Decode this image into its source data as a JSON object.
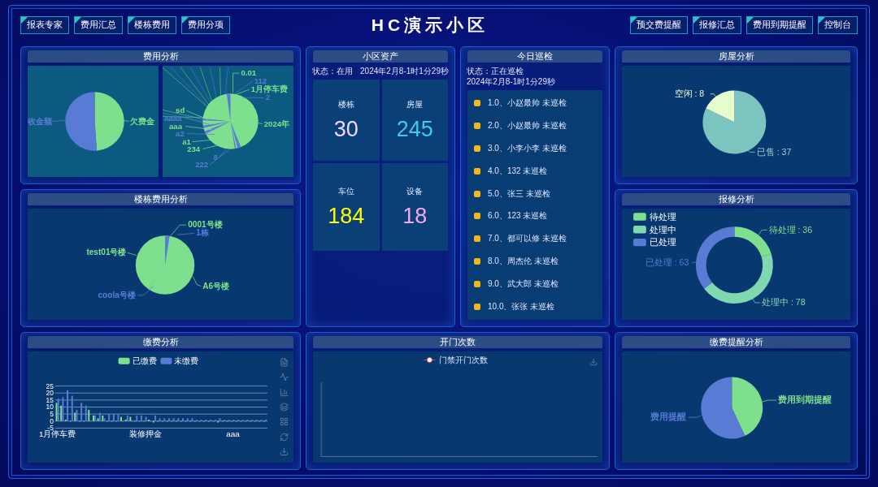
{
  "header": {
    "title": "HC演示小区",
    "left_buttons": [
      "报表专家",
      "费用汇总",
      "楼栋费用",
      "费用分项"
    ],
    "right_buttons": [
      "预交费提醒",
      "报修汇总",
      "费用到期提醒",
      "控制台"
    ]
  },
  "fee_analysis": {
    "title": "费用分析",
    "left_labels": [
      {
        "text": "收金额",
        "color": "#5a7bd5"
      },
      {
        "text": "欠费金",
        "color": "#7ee08e"
      }
    ],
    "right_labels": [
      {
        "text": "0.01",
        "color": "#7ee08e"
      },
      {
        "text": "112",
        "color": "#5a7bd5"
      },
      {
        "text": "1月停车费",
        "color": "#7ee08e"
      },
      {
        "text": "2",
        "color": "#5a7bd5"
      },
      {
        "text": "2024年",
        "color": "#7ee08e"
      },
      {
        "text": "sd",
        "color": "#7ee08e"
      },
      {
        "text": "aaaa",
        "color": "#5a7bd5"
      },
      {
        "text": "aaa",
        "color": "#7ee08e"
      },
      {
        "text": "a2",
        "color": "#5a7bd5"
      },
      {
        "text": "a1",
        "color": "#7ee08e"
      },
      {
        "text": "234",
        "color": "#7ee08e"
      },
      {
        "text": "8",
        "color": "#5a7bd5"
      },
      {
        "text": "222",
        "color": "#5a7bd5"
      }
    ]
  },
  "building_fees": {
    "title": "楼栋费用分析",
    "labels": [
      {
        "text": "0001号楼",
        "color": "#7ee08e"
      },
      {
        "text": "1栋",
        "color": "#5a7bd5"
      },
      {
        "text": "test01号楼",
        "color": "#7ee08e"
      },
      {
        "text": "A6号楼",
        "color": "#7ee08e"
      },
      {
        "text": "coola号楼",
        "color": "#5a7bd5"
      }
    ]
  },
  "payment_analysis": {
    "title": "缴费分析",
    "chart_data": {
      "type": "bar",
      "legend": "top",
      "grid": true,
      "ylim": [
        -5,
        25
      ],
      "yticks": [
        -5,
        0,
        5,
        10,
        15,
        20,
        25
      ],
      "categories": [
        "1月停车费",
        null,
        null,
        null,
        null,
        null,
        null,
        null,
        null,
        null,
        null,
        null,
        null,
        null,
        null,
        null,
        null,
        null,
        null,
        "装修押金",
        null,
        null,
        null,
        null,
        null,
        null,
        null,
        null,
        null,
        null,
        null,
        null,
        null,
        null,
        null,
        null,
        null,
        null,
        "aaa",
        null,
        null,
        null,
        null,
        null,
        null,
        null
      ],
      "series": [
        {
          "name": "已缴费",
          "color": "#7ee08e",
          "values": [
            13,
            11,
            1,
            0,
            6,
            0,
            0,
            8,
            4,
            2,
            4,
            0,
            0,
            0,
            3,
            1,
            3,
            0,
            0,
            0,
            1,
            -1,
            0,
            0,
            0,
            0,
            0,
            0,
            0,
            0,
            0,
            0,
            0,
            0,
            0,
            -1,
            0,
            0,
            0,
            0,
            0,
            0,
            0,
            0,
            0,
            0
          ]
        },
        {
          "name": "未缴费",
          "color": "#5a7bd5",
          "values": [
            16,
            17,
            22,
            18,
            8,
            13,
            11,
            0,
            4,
            6,
            2,
            5,
            5,
            5,
            0,
            4,
            0,
            4,
            4,
            3,
            0,
            4,
            2,
            2,
            2,
            2,
            2,
            2,
            2,
            2,
            1,
            1,
            1,
            1,
            1,
            2,
            1,
            1,
            1,
            1,
            1,
            1,
            1,
            1,
            1,
            1
          ]
        }
      ]
    }
  },
  "assets": {
    "title": "小区资产",
    "status": "状态：在用",
    "time": "2024年2月8-1时1分29秒",
    "tiles": [
      {
        "label": "楼栋",
        "value": "30",
        "color": "#f0d8ff"
      },
      {
        "label": "房屋",
        "value": "245",
        "color": "#3ecbee"
      },
      {
        "label": "车位",
        "value": "184",
        "color": "#ffff00"
      },
      {
        "label": "设备",
        "value": "18",
        "color": "#f4a8f0"
      }
    ]
  },
  "patrol": {
    "title": "今日巡检",
    "status": "状态：正在巡检",
    "time": "2024年2月8-1时1分29秒",
    "items": [
      "1.0、小赵最帅 未巡检",
      "2.0、小赵最帅 未巡检",
      "3.0、小李小李 未巡检",
      "4.0、132 未巡检",
      "5.0、张三 未巡检",
      "6.0、123 未巡检",
      "7.0、都可以修 未巡检",
      "8.0、周杰伦 未巡检",
      "9.0、武大郎 未巡检",
      "10.0、张张 未巡检"
    ]
  },
  "door_opens": {
    "title": "开门次数",
    "legend": "门禁开门次数"
  },
  "house_analysis": {
    "title": "房屋分析",
    "chart_data": {
      "type": "pie",
      "values": [
        37,
        8
      ],
      "value_labels": [
        "已售 : 37",
        "空闲 : 8"
      ]
    }
  },
  "repair_analysis": {
    "title": "报修分析",
    "chart_data": {
      "type": "donut",
      "legend": "top-left",
      "categories": [
        "待处理",
        "处理中",
        "已处理"
      ],
      "values": [
        36,
        78,
        63
      ],
      "value_labels": [
        "待处理 : 36",
        "处理中 : 78",
        "已处理 : 63"
      ]
    }
  },
  "payment_reminders": {
    "title": "缴费提醒分析",
    "labels": [
      {
        "text": "费用到期提醒",
        "color": "#7ee08e"
      },
      {
        "text": "费用提醒",
        "color": "#5a7bd5"
      }
    ]
  }
}
